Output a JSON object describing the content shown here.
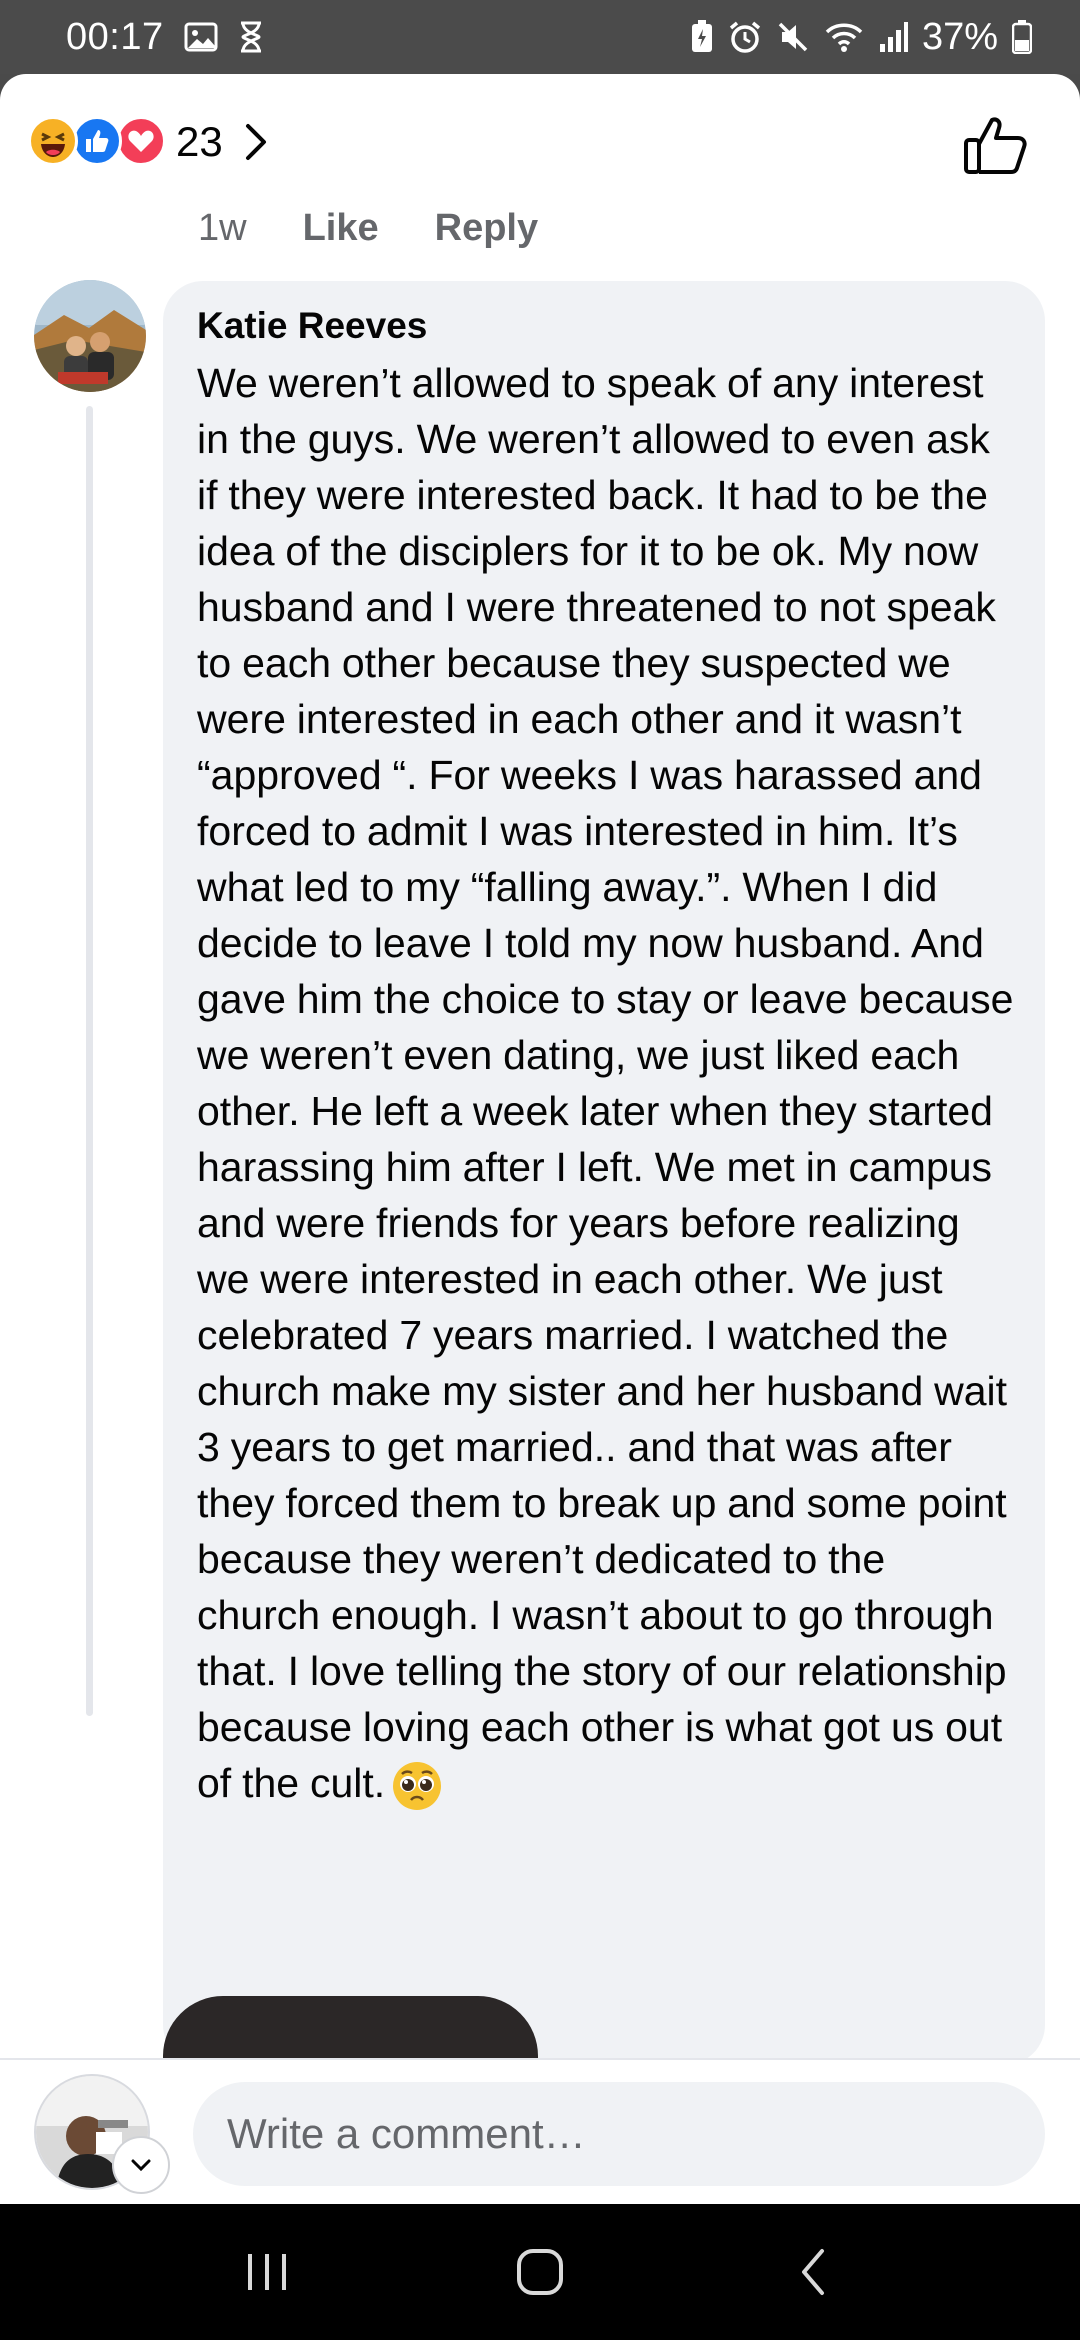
{
  "status_bar": {
    "time": "00:17",
    "battery": "37%",
    "left_icons": [
      "image-icon",
      "hourglass-icon"
    ],
    "right_icons": [
      "battery-saver-icon",
      "alarm-icon",
      "mute-icon",
      "wifi-icon",
      "signal-icon",
      "battery-icon"
    ]
  },
  "reactions": {
    "types": [
      "haha",
      "like",
      "love"
    ],
    "count": "23"
  },
  "parent_comment_meta": {
    "time": "1w",
    "like_label": "Like",
    "reply_label": "Reply"
  },
  "comment": {
    "author": "Katie Reeves",
    "text": "We weren’t allowed to speak of any interest in the guys. We weren’t allowed to even ask if they were interested back. It had to be the idea of the disciplers for it to be ok. My now husband and I were threatened to not speak to each other because they suspected we were interested in each other and it wasn’t “approved “. For weeks I was harassed and forced to admit I was interested in him. It’s what led to my “falling away.”. When I did decide to leave I told my now husband. And gave him the choice to stay or leave because we weren’t even dating, we just liked each other. He left a week later when they started harassing him after I left. We met in campus and were friends for years before realizing we were interested in each other. We just celebrated 7 years married. I watched the church make my sister and her husband wait 3 years to get married.. and that was after they forced them to break up and some point because they weren’t dedicated to the church enough. I wasn’t about to go through that. I love telling the story of our relationship because loving each other is what got us out of the cult.",
    "trailing_emoji": "pleading-face-emoji"
  },
  "composer": {
    "placeholder": "Write a comment…"
  },
  "colors": {
    "like_blue": "#1877f2",
    "love_red": "#f33e58",
    "haha_yellow": "#f7b125",
    "bubble_bg": "#f0f2f5",
    "secondary_text": "#65676b"
  }
}
